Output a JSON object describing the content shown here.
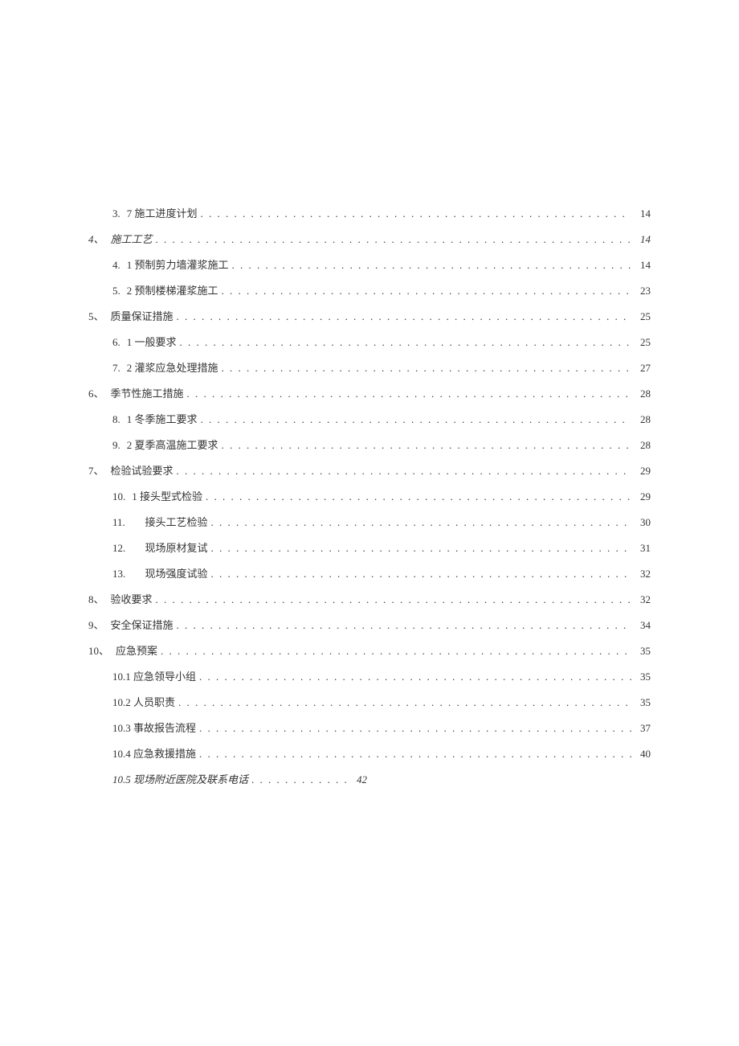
{
  "toc": [
    {
      "level": 2,
      "num": "3.",
      "label": "7 施工进度计划",
      "page": "14",
      "italic": false
    },
    {
      "level": 1,
      "num": "4、",
      "label": "施工工艺",
      "page": "14",
      "italic": true
    },
    {
      "level": 2,
      "num": "4.",
      "label": "1 预制剪力墙灌浆施工",
      "page": "14",
      "italic": false
    },
    {
      "level": 2,
      "num": "5.",
      "label": "2 预制楼梯灌浆施工",
      "page": "23",
      "italic": false
    },
    {
      "level": 1,
      "num": "5、",
      "label": "质量保证措施",
      "page": "25",
      "italic": false
    },
    {
      "level": 2,
      "num": "6.",
      "label": "1 一般要求",
      "page": "25",
      "italic": false
    },
    {
      "level": 2,
      "num": "7.",
      "label": "2 灌浆应急处理措施",
      "page": "27",
      "italic": false
    },
    {
      "level": 1,
      "num": "6、",
      "label": "季节性施工措施",
      "page": "28",
      "italic": false
    },
    {
      "level": 2,
      "num": "8.",
      "label": "1 冬季施工要求",
      "page": "28",
      "italic": false
    },
    {
      "level": 2,
      "num": "9.",
      "label": "2 夏季高温施工要求",
      "page": "28",
      "italic": false
    },
    {
      "level": 1,
      "num": "7、",
      "label": "检验试验要求",
      "page": "29",
      "italic": false
    },
    {
      "level": 2,
      "num": "10.",
      "label": "1 接头型式检验",
      "page": "29",
      "italic": false
    },
    {
      "level": 2,
      "num": "11.",
      "label": "接头工艺检验",
      "page": "30",
      "italic": false,
      "gap": true
    },
    {
      "level": 2,
      "num": "12.",
      "label": "现场原材复试",
      "page": "31",
      "italic": false,
      "gap": true
    },
    {
      "level": 2,
      "num": "13.",
      "label": "现场强度试验",
      "page": "32",
      "italic": false,
      "gap": true
    },
    {
      "level": 1,
      "num": "8、",
      "label": "验收要求",
      "page": "32",
      "italic": false
    },
    {
      "level": 1,
      "num": "9、",
      "label": "安全保证措施",
      "page": "34",
      "italic": false
    },
    {
      "level": 1,
      "num": "10、",
      "label": "应急预案",
      "page": "35",
      "italic": false
    },
    {
      "level": 2,
      "num": "",
      "label": "10.1 应急领导小组",
      "page": "35",
      "italic": false
    },
    {
      "level": 2,
      "num": "",
      "label": "10.2 人员职责",
      "page": "35",
      "italic": false
    },
    {
      "level": 2,
      "num": "",
      "label": "10.3 事故报告流程",
      "page": "37",
      "italic": false
    },
    {
      "level": 2,
      "num": "",
      "label": "10.4 应急救援措施",
      "page": "40",
      "italic": false
    },
    {
      "level": 2,
      "num": "",
      "label": "10.5 现场附近医院及联系电话",
      "page": "42",
      "italic": true,
      "short": true
    }
  ]
}
